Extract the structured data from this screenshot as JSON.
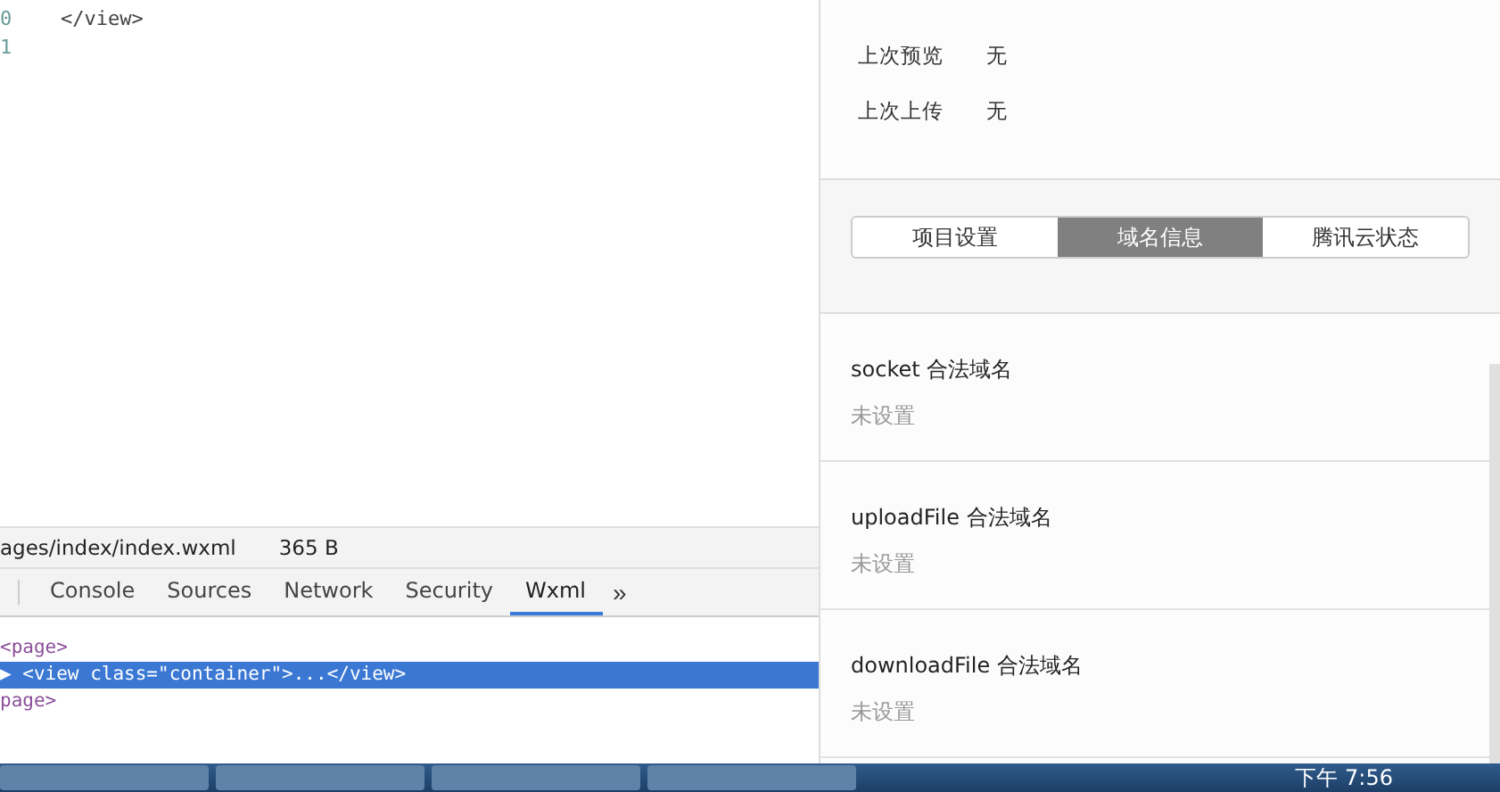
{
  "editor": {
    "lines": [
      {
        "number": "0",
        "code": "</view>"
      },
      {
        "number": "1"
      }
    ]
  },
  "file_bar": {
    "path": "ages/index/index.wxml",
    "size": "365 B"
  },
  "devtools_tabs": [
    {
      "label": "Console",
      "selected": false
    },
    {
      "label": "Sources",
      "selected": false
    },
    {
      "label": "Network",
      "selected": false
    },
    {
      "label": "Security",
      "selected": false
    },
    {
      "label": "Wxml",
      "selected": true
    }
  ],
  "devtools_more": "»",
  "wxml_tree": [
    {
      "text": "<page>",
      "selected": false
    },
    {
      "text": "▶ <view class=\"container\">...</view>",
      "selected": true
    },
    {
      "text": "page>",
      "selected": false
    }
  ],
  "project_info": [
    {
      "label": "上次预览",
      "value": "无"
    },
    {
      "label": "上次上传",
      "value": "无"
    }
  ],
  "panel_tabs": [
    {
      "label": "项目设置",
      "selected": false
    },
    {
      "label": "域名信息",
      "selected": true
    },
    {
      "label": "腾讯云状态",
      "selected": false
    }
  ],
  "domains": [
    {
      "name": "socket 合法域名",
      "value": "未设置"
    },
    {
      "name": "uploadFile 合法域名",
      "value": "未设置"
    },
    {
      "name": "downloadFile 合法域名",
      "value": "未设置"
    }
  ],
  "taskbar": {
    "clock": "下午 7:56"
  }
}
